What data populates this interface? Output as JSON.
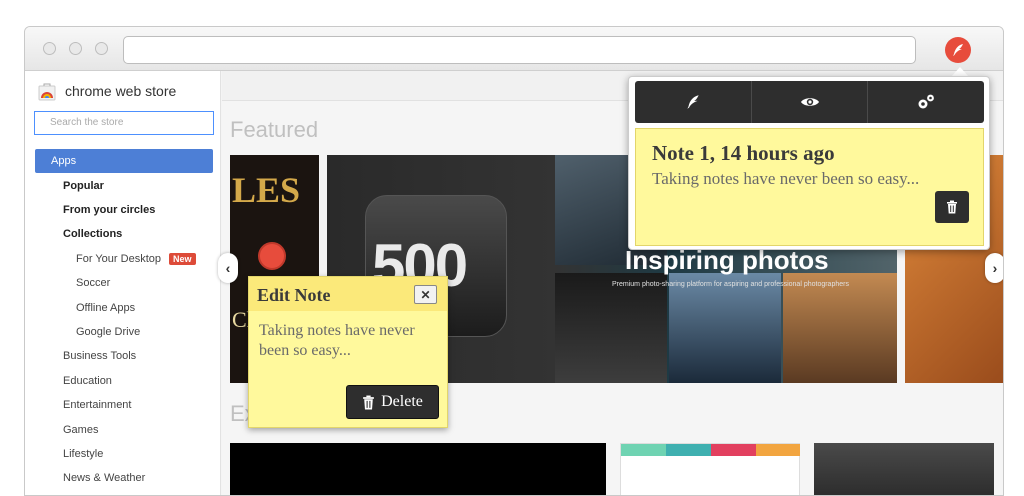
{
  "sidebar": {
    "logo_text": "chrome web store",
    "search_placeholder": "Search the store",
    "apps_label": "Apps",
    "items": [
      {
        "label": "Popular"
      },
      {
        "label": "From your circles"
      },
      {
        "label": "Collections"
      }
    ],
    "collections": [
      {
        "label": "For Your Desktop",
        "badge": "New"
      },
      {
        "label": "Soccer"
      },
      {
        "label": "Offline Apps"
      },
      {
        "label": "Google Drive"
      }
    ],
    "categories": [
      {
        "label": "Business Tools"
      },
      {
        "label": "Education"
      },
      {
        "label": "Entertainment"
      },
      {
        "label": "Games"
      },
      {
        "label": "Lifestyle"
      },
      {
        "label": "News & Weather"
      }
    ]
  },
  "main": {
    "featured_title": "Featured",
    "second_title": "Ex",
    "banner_left_text": "LES",
    "banner_left_side": "Ch",
    "banner_number": "500",
    "banner_headline": "Inspiring photos",
    "banner_tagline": "Premium photo-sharing platform for aspiring and professional photographers",
    "prev_arrow": "‹",
    "next_arrow": "›"
  },
  "popup": {
    "toolbar": [
      "feather-icon",
      "eye-icon",
      "gears-icon"
    ],
    "note_title": "Note 1, 14 hours ago",
    "note_body": "Taking notes have never been so easy..."
  },
  "edit_note": {
    "title": "Edit Note",
    "close_glyph": "✕",
    "text": "Taking notes have never been so easy...",
    "delete_label": "Delete"
  },
  "colors": {
    "accent": "#e74c3c",
    "note_yellow": "#fff99c",
    "nav_blue": "#4d7fd6",
    "toolbar_dark": "#2e2e2e"
  }
}
